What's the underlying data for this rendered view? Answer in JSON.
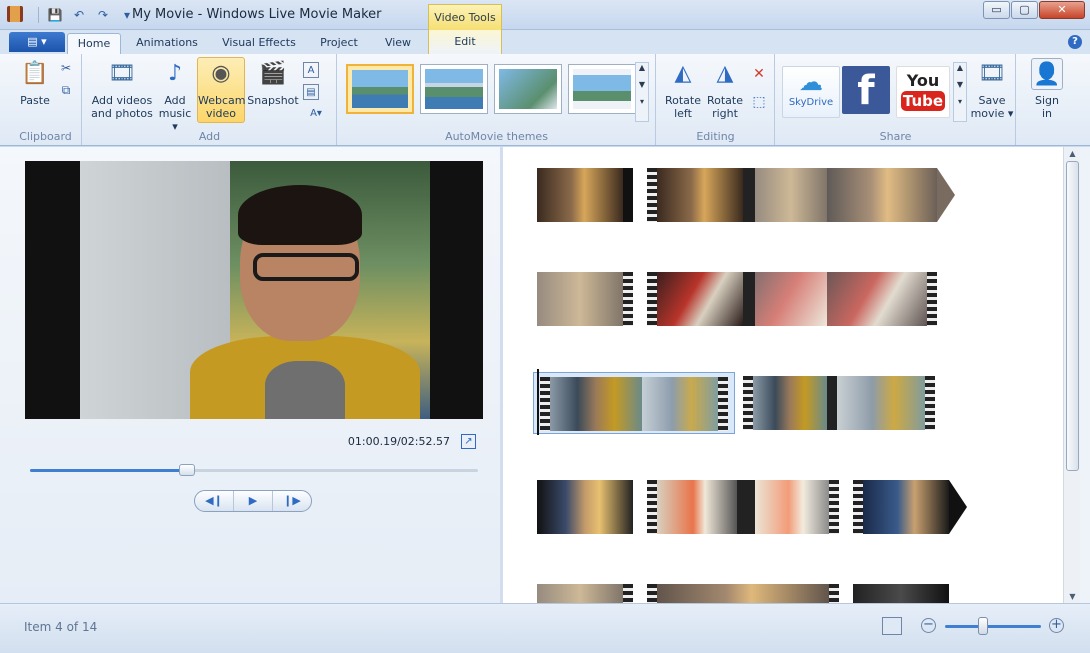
{
  "window": {
    "title": "My Movie - Windows Live Movie Maker",
    "context_tab_title": "Video Tools",
    "controls": {
      "minimize": "▭",
      "maximize": "▢",
      "close": "✕"
    }
  },
  "qat": {
    "save": "💾",
    "undo": "↶",
    "redo": "↷",
    "more": "▾"
  },
  "tabs": {
    "file": "▤ ▾",
    "items": [
      {
        "label": "Home"
      },
      {
        "label": "Animations"
      },
      {
        "label": "Visual Effects"
      },
      {
        "label": "Project"
      },
      {
        "label": "View"
      },
      {
        "label": "Edit"
      }
    ],
    "help": "?"
  },
  "ribbon": {
    "clipboard": {
      "paste_icon": "📋",
      "paste": "Paste",
      "cut_icon": "✂",
      "copy_icon": "⧉",
      "label": "Clipboard"
    },
    "add": {
      "add_videos_icon": "🎞",
      "add_videos_line1": "Add videos",
      "add_videos_line2": "and photos",
      "add_music_icon": "♪",
      "add_music_line1": "Add",
      "add_music_line2": "music ▾",
      "webcam_icon": "◉",
      "webcam_line1": "Webcam",
      "webcam_line2": "video",
      "snapshot_icon": "🎬",
      "snapshot": "Snapshot",
      "caption_icon": "A",
      "title_icon": "▤",
      "credits_icon": "A▾",
      "label": "Add"
    },
    "automovie": {
      "label": "AutoMovie themes",
      "scroll_up": "▲",
      "scroll_down": "▼",
      "more": "▾"
    },
    "editing": {
      "rotate_left_icon": "◭",
      "rotate_left_line1": "Rotate",
      "rotate_left_line2": "left",
      "rotate_right_icon": "◮",
      "rotate_right_line1": "Rotate",
      "rotate_right_line2": "right",
      "remove_icon": "✕",
      "select_all_icon": "⬚",
      "label": "Editing"
    },
    "share": {
      "skydrive": "SkyDrive",
      "facebook": "f",
      "youtube_line1": "You",
      "youtube_line2": "Tube",
      "save_movie_icon": "🎞",
      "save_movie_line1": "Save",
      "save_movie_line2": "movie ▾",
      "label": "Share"
    },
    "signin": {
      "icon": "👤",
      "line1": "Sign",
      "line2": "in"
    }
  },
  "preview": {
    "timecode": "01:00.19/02:52.57",
    "popout_icon": "↗",
    "seek_progress": 0.35,
    "prev_frame": "◀❙",
    "play": "▶",
    "next_frame": "❙▶"
  },
  "storyboard": {
    "scroll_up": "▲",
    "scroll_down": "▼"
  },
  "status": {
    "text": "Item 4 of 14",
    "zoom_out": "−",
    "zoom_in": "+",
    "zoom_level": 0.4
  },
  "colors": {
    "accent": "#2f6bc2",
    "ribbon_bg": "#f5f8fc",
    "context_yellow": "#f6df74"
  }
}
